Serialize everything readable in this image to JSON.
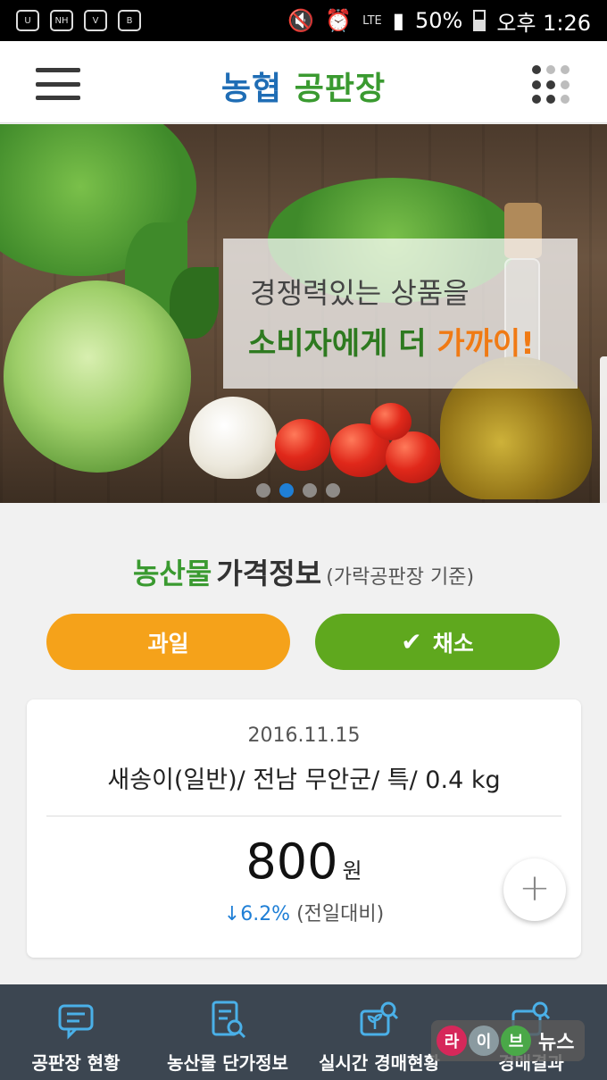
{
  "status_bar": {
    "lte": "LTE",
    "battery": "50%",
    "time": "오후 1:26",
    "left_icons": [
      "u-plus-icon",
      "nh-shield-icon",
      "v3-icon",
      "band-icon"
    ]
  },
  "header": {
    "logo_part1": "농협",
    "logo_part2": "공판장",
    "menu_icon": "hamburger-icon",
    "apps_icon": "apps-grid-icon"
  },
  "banner": {
    "line1": "경쟁력있는 상품을",
    "line2_main": "소비자에게 더 ",
    "line2_highlight": "가까이!",
    "slides": 4,
    "active_slide": 2
  },
  "price_info": {
    "title_green": "농산물",
    "title_dark": "가격정보",
    "title_sub": "(가락공판장 기준)",
    "tab_fruit": "과일",
    "tab_vegetable": "채소",
    "selected_tab": "채소"
  },
  "card": {
    "date": "2016.11.15",
    "item": "새송이(일반)/ 전남 무안군/ 특/ 0.4 kg",
    "price": "800",
    "unit": "원",
    "change": "↓6.2%",
    "compare": "(전일대비)"
  },
  "bottom_nav": [
    {
      "label": "공판장 현황",
      "icon": "chat-bubble-icon"
    },
    {
      "label": "농산물 단가정보",
      "icon": "document-search-icon"
    },
    {
      "label": "실시간 경매현황",
      "icon": "sprout-search-icon"
    },
    {
      "label": "경매결과",
      "icon": "won-search-icon"
    }
  ],
  "watermark": {
    "c1": "라",
    "c2": "이",
    "c3": "브",
    "text": "뉴스"
  },
  "colors": {
    "brand_green": "#3a9a30",
    "brand_blue": "#1f6db5",
    "fruit_orange": "#f5a21a",
    "vegetable_green": "#5fa81e",
    "nav_bg": "#3c4651",
    "down_blue": "#1f7fd6"
  }
}
